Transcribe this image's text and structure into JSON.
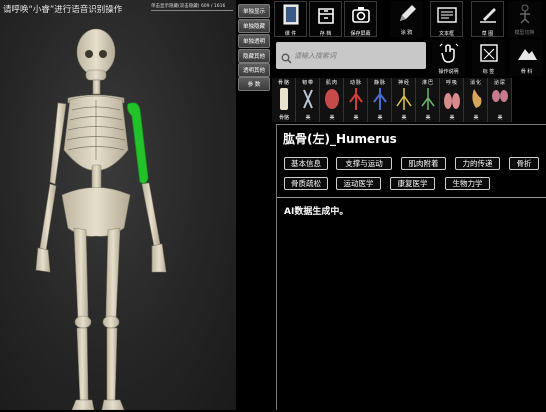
{
  "viewport": {
    "voice_hint": "请呼唤“小睿”进行语音识别操作",
    "top_info": "单击显示隐藏(双击隐藏)   609 / 1616"
  },
  "visibility_buttons": [
    {
      "label": "单独显示"
    },
    {
      "label": "单独隐藏"
    },
    {
      "label": "单独透明"
    },
    {
      "label": "隐藏其他"
    },
    {
      "label": "透明其他"
    },
    {
      "label": "参 数"
    }
  ],
  "toolbar": [
    {
      "label": "课 件",
      "icon": "book-icon"
    },
    {
      "label": "存 档",
      "icon": "archive-icon"
    },
    {
      "label": "保存屏幕",
      "icon": "camera-icon"
    },
    {
      "label": "涂 鸦",
      "icon": "pencil-icon"
    },
    {
      "label": "文本框",
      "icon": "textbox-icon"
    },
    {
      "label": "草 图",
      "icon": "sketch-icon"
    },
    {
      "label": "模型切换",
      "icon": "model-switch-icon"
    }
  ],
  "toolbar_row2": [
    {
      "label": "操作说明",
      "icon": "touch-gesture-icon"
    },
    {
      "label": "标 签",
      "icon": "tag-icon"
    },
    {
      "label": "骨 科",
      "icon": "mountain-icon"
    }
  ],
  "search": {
    "placeholder": "请输入搜索词"
  },
  "categories": [
    {
      "title": "骨骼",
      "bottom": "骨骼",
      "color": "#e9e2cf"
    },
    {
      "title": "韧带",
      "bottom": "美",
      "color": "#b9c6d4"
    },
    {
      "title": "肌肉",
      "bottom": "美",
      "color": "#c64a4a"
    },
    {
      "title": "动脉",
      "bottom": "美",
      "color": "#d23c3c"
    },
    {
      "title": "静脉",
      "bottom": "美",
      "color": "#4b6bd0"
    },
    {
      "title": "神经",
      "bottom": "美",
      "color": "#e0c84a"
    },
    {
      "title": "淋巴",
      "bottom": "美",
      "color": "#6fb36f"
    },
    {
      "title": "呼吸",
      "bottom": "美",
      "color": "#d98a8a"
    },
    {
      "title": "消化",
      "bottom": "美",
      "color": "#d7a35d"
    },
    {
      "title": "泌尿",
      "bottom": "美",
      "color": "#c9798d"
    }
  ],
  "detail": {
    "title": "肱骨(左)_Humerus",
    "tags": [
      "基本信息",
      "支撑与运动",
      "肌肉附着",
      "力的传递",
      "骨折",
      "骨质疏松",
      "运动医学",
      "康复医学",
      "生物力学"
    ],
    "ai_status": "AI数据生成中。"
  },
  "colors": {
    "highlight": "#22c22a",
    "bone": "#ddd6c2"
  }
}
